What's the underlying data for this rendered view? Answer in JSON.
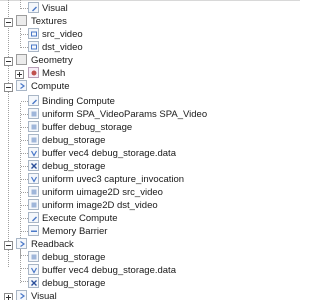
{
  "tree": {
    "visual_top": {
      "label": "Visual",
      "icon": "shader-icon"
    },
    "textures": {
      "label": "Textures",
      "icon": "folder-icon",
      "expanded": true,
      "children": [
        {
          "label": "src_video",
          "icon": "texture-icon"
        },
        {
          "label": "dst_video",
          "icon": "texture-icon"
        }
      ]
    },
    "geometry": {
      "label": "Geometry",
      "icon": "folder-icon",
      "expanded": true,
      "children": [
        {
          "label": "Mesh",
          "icon": "mesh-icon",
          "expanded": false
        }
      ]
    },
    "compute": {
      "label": "Compute",
      "icon": "compute-icon",
      "expanded": true,
      "children": [
        {
          "label": "Binding Compute",
          "icon": "shader-icon"
        },
        {
          "label": "uniform SPA_VideoParams SPA_Video",
          "icon": "uniform-icon"
        },
        {
          "label": "buffer debug_storage",
          "icon": "buffer-icon"
        },
        {
          "label": "debug_storage",
          "icon": "buffer-icon"
        },
        {
          "label": "buffer vec4 debug_storage.data",
          "icon": "vector-icon"
        },
        {
          "label": "debug_storage",
          "icon": "cross-icon"
        },
        {
          "label": "uniform uvec3 capture_invocation",
          "icon": "uniform-icon"
        },
        {
          "label": "uniform uimage2D src_video",
          "icon": "uniform-icon"
        },
        {
          "label": "uniform image2D dst_video",
          "icon": "uniform-icon"
        },
        {
          "label": "Execute Compute",
          "icon": "shader-icon"
        },
        {
          "label": "Memory Barrier",
          "icon": "barrier-icon"
        }
      ]
    },
    "readback": {
      "label": "Readback",
      "icon": "compute-icon",
      "expanded": true,
      "children": [
        {
          "label": "debug_storage",
          "icon": "buffer-icon"
        },
        {
          "label": "buffer vec4 debug_storage.data",
          "icon": "vector-icon"
        },
        {
          "label": "debug_storage",
          "icon": "cross-icon"
        }
      ]
    },
    "visual_bottom": {
      "label": "Visual",
      "icon": "compute-icon",
      "expanded": false
    }
  },
  "colors": {
    "accent": "#3b6fd6",
    "tree_lines": "#a0a0a0",
    "icon_border": "#a9b6c6",
    "folder_fill": "#ececec"
  }
}
